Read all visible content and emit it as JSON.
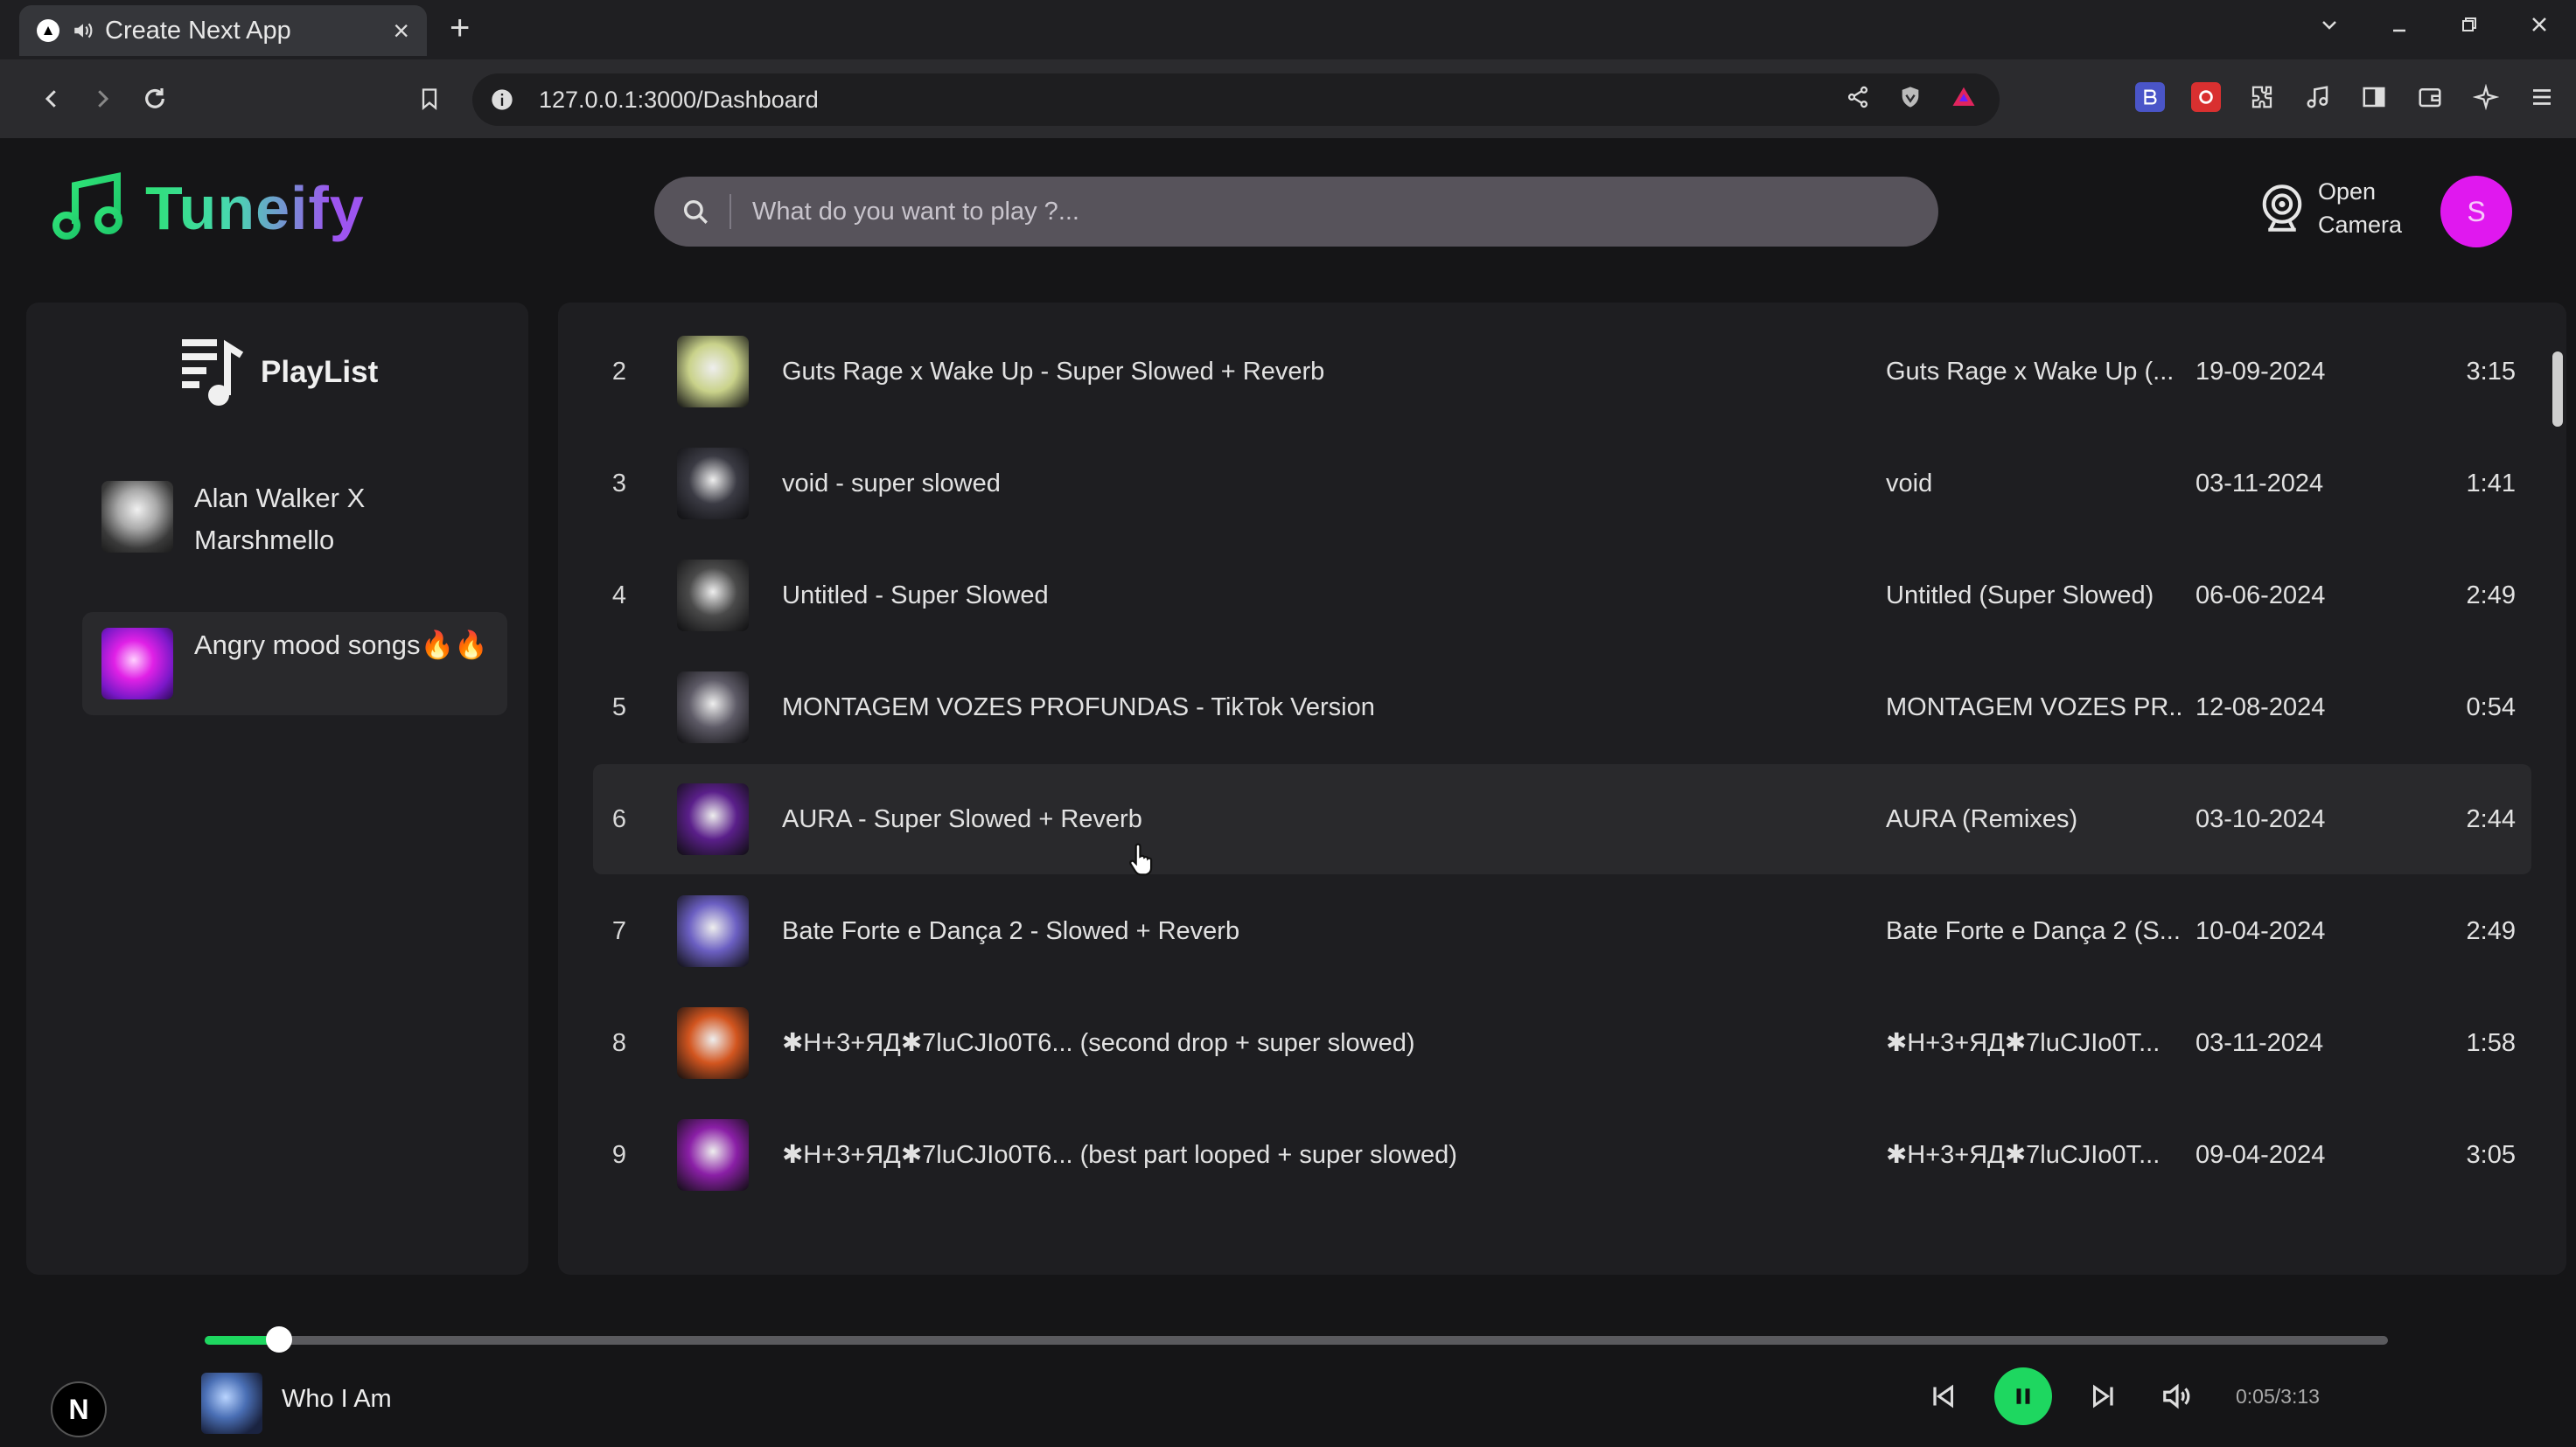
{
  "browser": {
    "tab_title": "Create Next App",
    "favicon_letter": "▲",
    "url": "127.0.0.1:3000/Dashboard"
  },
  "header": {
    "logo_text": "Tuneify",
    "search_placeholder": "What do you want to play ?...",
    "camera_label": "Open Camera",
    "avatar_letter": "S"
  },
  "sidebar": {
    "title": "PlayList",
    "playlists": [
      {
        "name": "Alan Walker X Marshmello"
      },
      {
        "name": "Angry mood songs🔥🔥"
      }
    ]
  },
  "songs": [
    {
      "num": "2",
      "title": "Guts Rage x Wake Up - Super Slowed + Reverb",
      "album": "Guts Rage x Wake Up (...",
      "date": "19-09-2024",
      "duration": "3:15",
      "thumb_color": "#c9d28a"
    },
    {
      "num": "3",
      "title": "void - super slowed",
      "album": "void",
      "date": "03-11-2024",
      "duration": "1:41",
      "thumb_color": "#3b3b44"
    },
    {
      "num": "4",
      "title": "Untitled - Super Slowed",
      "album": "Untitled (Super Slowed)",
      "date": "06-06-2024",
      "duration": "2:49",
      "thumb_color": "#4a4a4a"
    },
    {
      "num": "5",
      "title": "MONTAGEM VOZES PROFUNDAS - TikTok Version",
      "album": "MONTAGEM VOZES PR...",
      "date": "12-08-2024",
      "duration": "0:54",
      "thumb_color": "#5d5a66"
    },
    {
      "num": "6",
      "title": "AURA - Super Slowed + Reverb",
      "album": "AURA (Remixes)",
      "date": "03-10-2024",
      "duration": "2:44",
      "thumb_color": "#5a1f8a"
    },
    {
      "num": "7",
      "title": "Bate Forte e Dança 2 - Slowed + Reverb",
      "album": "Bate Forte e Dança 2 (S...",
      "date": "10-04-2024",
      "duration": "2:49",
      "thumb_color": "#6b5fc2"
    },
    {
      "num": "8",
      "title": "✱H+3+ЯД✱7luCJIo0T6... (second drop + super slowed)",
      "album": "✱H+3+ЯД✱7luCJIo0T...",
      "date": "03-11-2024",
      "duration": "1:58",
      "thumb_color": "#d2551f"
    },
    {
      "num": "9",
      "title": "✱H+3+ЯД✱7luCJIo0T6... (best part looped + super slowed)",
      "album": "✱H+3+ЯД✱7luCJIo0T...",
      "date": "09-04-2024",
      "duration": "3:05",
      "thumb_color": "#8a1fa6"
    }
  ],
  "player": {
    "n_badge": "N",
    "now_playing": "Who I Am",
    "time": "0:05/3:13",
    "progress": 0.034
  },
  "colors": {
    "accent": "#1ed760",
    "avatar": "#e018ef",
    "background": "#151517",
    "panel": "#1e1e21"
  }
}
